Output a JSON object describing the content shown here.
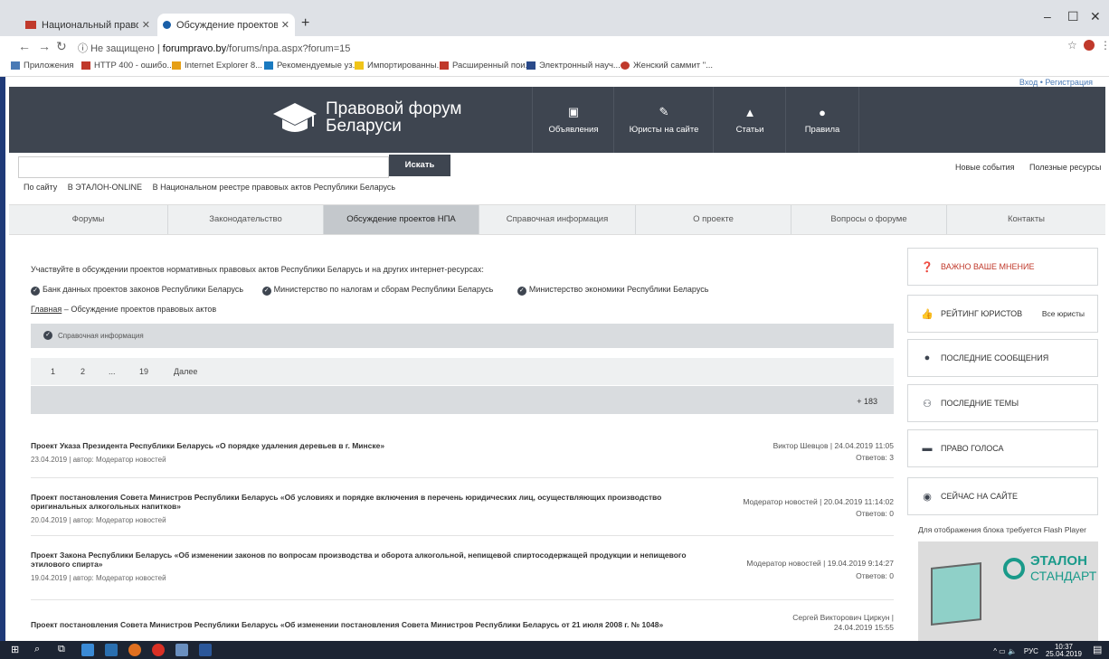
{
  "browser": {
    "tabs": [
      {
        "title": "Национальный правовой Инте",
        "active": false
      },
      {
        "title": "Обсуждение проектов правов",
        "active": true
      }
    ],
    "url_prefix": "Не защищено",
    "url_domain": "forumpravo.by",
    "url_path": "/forums/npa.aspx?forum=15",
    "bookmarks": [
      "Приложения",
      "HTTP 400 - ошибо...",
      "Internet Explorer 8...",
      "Рекомендуемые уз...",
      "Импортированны...",
      "Расширенный пои...",
      "Электронный науч...",
      "Женский саммит \"..."
    ]
  },
  "top_links": "Вход  •  Регистрация",
  "header": {
    "logo_line1": "Правовой форум",
    "logo_line2": "Беларуси",
    "nav": [
      "Объявления",
      "Юристы на сайте",
      "Статьи",
      "Правила"
    ]
  },
  "search": {
    "button": "Искать",
    "options": [
      "По сайту",
      "В ЭТАЛОН-ONLINE",
      "В Национальном реестре правовых актов Республики Беларусь"
    ],
    "right_links": [
      "Новые события",
      "Полезные ресурсы"
    ]
  },
  "menu": [
    "Форумы",
    "Законодательство",
    "Обсуждение проектов НПА",
    "Справочная информация",
    "О проекте",
    "Вопросы о форуме",
    "Контакты"
  ],
  "menu_active": 2,
  "intro": "Участвуйте в обсуждении проектов нормативных правовых актов Республики Беларусь и на других интернет-ресурсах:",
  "sources": [
    "Банк данных проектов законов Республики Беларусь",
    "Министерство по налогам и сборам Республики Беларусь",
    "Министерство экономики Республики Беларусь"
  ],
  "breadcrumb": {
    "home": "Главная",
    "sep": "–",
    "current": "Обсуждение проектов правовых актов"
  },
  "subsection": "Справочная информация",
  "pager": [
    "1",
    "2",
    "...",
    "19",
    "Далее"
  ],
  "topic_count": "+ 183",
  "topics": [
    {
      "title": "Проект Указа Президента Республики Беларусь «О порядке удаления деревьев в г. Минске»",
      "meta": "23.04.2019 | автор: Модератор новостей",
      "last": "Виктор Шевцов | 24.04.2019 11:05",
      "replies": "Ответов: 3"
    },
    {
      "title": "Проект постановления Совета Министров Республики Беларусь «Об условиях и порядке включения в перечень юридических лиц, осуществляющих производство оригинальных алкогольных напитков»",
      "meta": "20.04.2019 | автор: Модератор новостей",
      "last": "Модератор новостей | 20.04.2019 11:14:02",
      "replies": "Ответов: 0"
    },
    {
      "title": "Проект Закона Республики Беларусь «Об изменении законов по вопросам производства и оборота алкогольной, непищевой спиртосодержащей продукции и непищевого этилового спирта»",
      "meta": "19.04.2019 | автор: Модератор новостей",
      "last": "Модератор новостей | 19.04.2019 9:14:27",
      "replies": "Ответов: 0"
    },
    {
      "title": "Проект постановления Совета Министров Республики Беларусь «Об изменении постановления Совета Министров Республики Беларусь от 21 июля 2008 г. № 1048»",
      "meta": "",
      "last": "Сергей Викторович Циркун | 24.04.2019 15:55",
      "replies": ""
    }
  ],
  "sidebar": [
    {
      "label": "ВАЖНО ВАШЕ МНЕНИЕ",
      "icon": "question-icon",
      "extra": ""
    },
    {
      "label": "РЕЙТИНГ ЮРИСТОВ",
      "icon": "thumbs-up-icon",
      "extra": "Все юристы"
    },
    {
      "label": "ПОСЛЕДНИЕ СООБЩЕНИЯ",
      "icon": "exclamation-icon",
      "extra": ""
    },
    {
      "label": "ПОСЛЕДНИЕ ТЕМЫ",
      "icon": "people-icon",
      "extra": ""
    },
    {
      "label": "ПРАВО ГОЛОСА",
      "icon": "comment-icon",
      "extra": ""
    },
    {
      "label": "СЕЙЧАС НА САЙТЕ",
      "icon": "person-icon",
      "extra": ""
    }
  ],
  "flash_note": "Для отображения блока требуется Flash Player",
  "ad": {
    "brand1": "ЭТАЛОН",
    "brand2": "СТАНДАРТ"
  },
  "tray": {
    "lang": "РУС",
    "time": "10:37",
    "date": "25.04.2019"
  },
  "colors": {
    "header": "#3e4550",
    "accent_red": "#c0392b",
    "brand_teal": "#1a9a8a"
  }
}
